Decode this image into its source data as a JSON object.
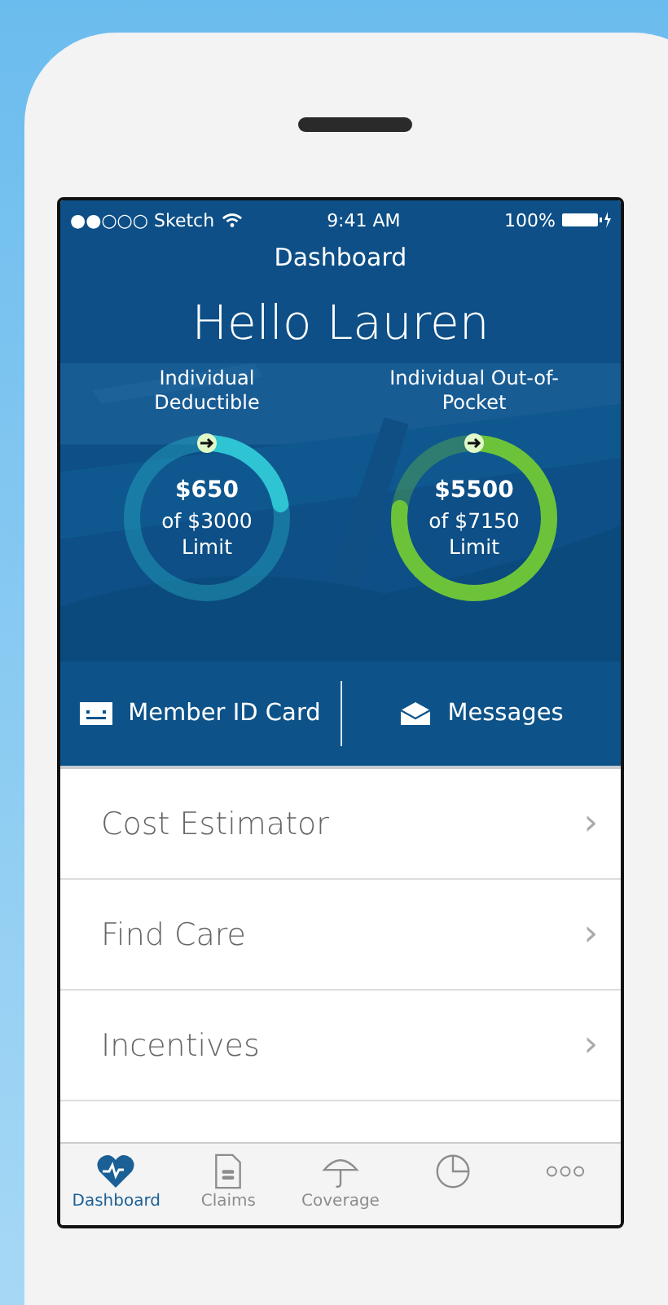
{
  "status_bar": {
    "carrier": "●●○○○ Sketch",
    "time": "9:41 AM",
    "battery": "100%"
  },
  "header": {
    "title": "Dashboard",
    "greeting": "Hello Lauren"
  },
  "meters": [
    {
      "label": "Individual Deductible",
      "amount": "$650",
      "limit": "of $3000",
      "limit_word": "Limit",
      "level": 0.22,
      "color": "#2ec4d4"
    },
    {
      "label": "Individual Out-of-Pocket",
      "amount": "$5500",
      "limit": "of $7150",
      "limit_word": "Limit",
      "level": 0.77,
      "color": "#6cc33a"
    }
  ],
  "actions": [
    {
      "kind": "card",
      "label": "Member ID Card"
    },
    {
      "kind": "mail",
      "label": "Messages"
    }
  ],
  "menu": [
    {
      "label": "Cost Estimator",
      "chevron": "›"
    },
    {
      "label": "Find Care",
      "chevron": "›"
    },
    {
      "label": "Incentives",
      "chevron": "›"
    }
  ],
  "tab_bar": [
    {
      "kind": "heart",
      "label": "Dashboard",
      "selected": true
    },
    {
      "kind": "doc",
      "label": "Claims",
      "selected": false
    },
    {
      "kind": "umbrella",
      "label": "Coverage",
      "selected": false
    },
    {
      "kind": "pie",
      "selected": false
    },
    {
      "kind": "dots",
      "selected": false
    }
  ]
}
